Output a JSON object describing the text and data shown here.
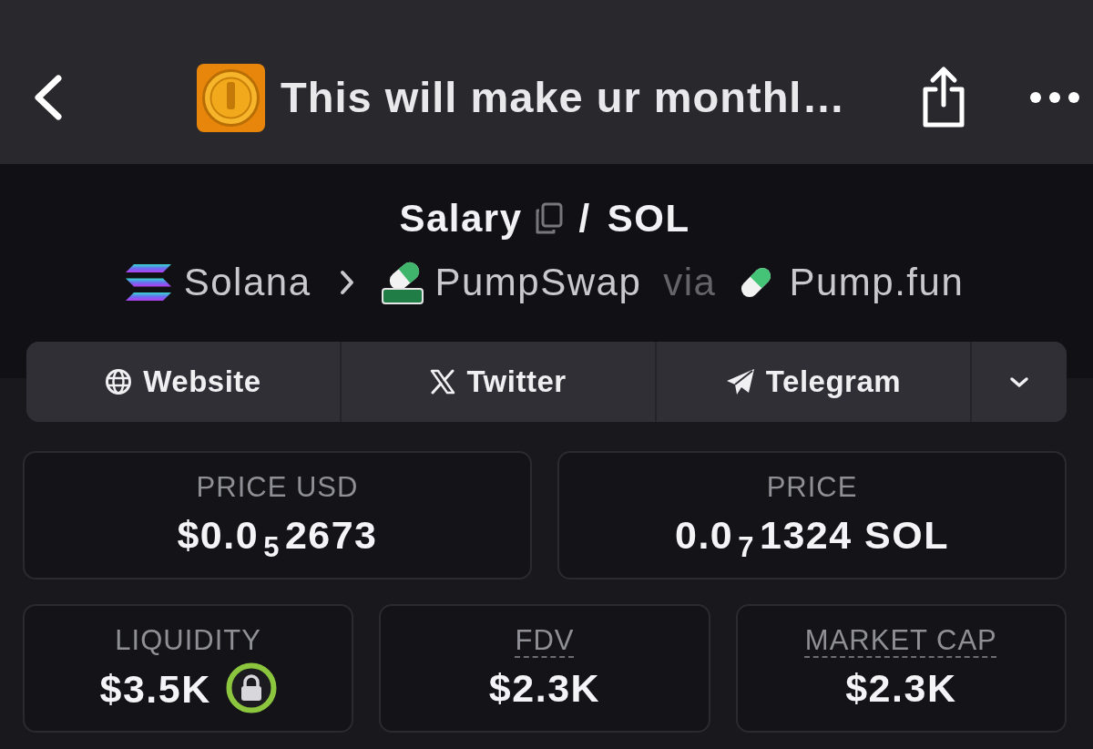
{
  "header": {
    "title": "This will make ur monthl…"
  },
  "pair": {
    "base": "Salary",
    "separator": "/",
    "quote": "SOL"
  },
  "route": {
    "chain": "Solana",
    "dex": "PumpSwap",
    "via": "via",
    "launchpad": "Pump.fun"
  },
  "links": [
    {
      "kind": "website",
      "label": "Website"
    },
    {
      "kind": "twitter",
      "label": "Twitter"
    },
    {
      "kind": "telegram",
      "label": "Telegram"
    },
    {
      "kind": "more"
    }
  ],
  "price_stats": [
    {
      "label": "PRICE USD",
      "value": "$0.0$_{5}$2673",
      "tooltip": false,
      "locked": false
    },
    {
      "label": "PRICE",
      "value": "0.0$_{7}$1324 SOL",
      "tooltip": false,
      "locked": false
    }
  ],
  "market_stats": [
    {
      "label": "LIQUIDITY",
      "value": "$3.5K",
      "tooltip": false,
      "locked": true
    },
    {
      "label": "FDV",
      "value": "$2.3K",
      "tooltip": true,
      "locked": false
    },
    {
      "label": "MARKET CAP",
      "value": "$2.3K",
      "tooltip": true,
      "locked": false
    }
  ]
}
